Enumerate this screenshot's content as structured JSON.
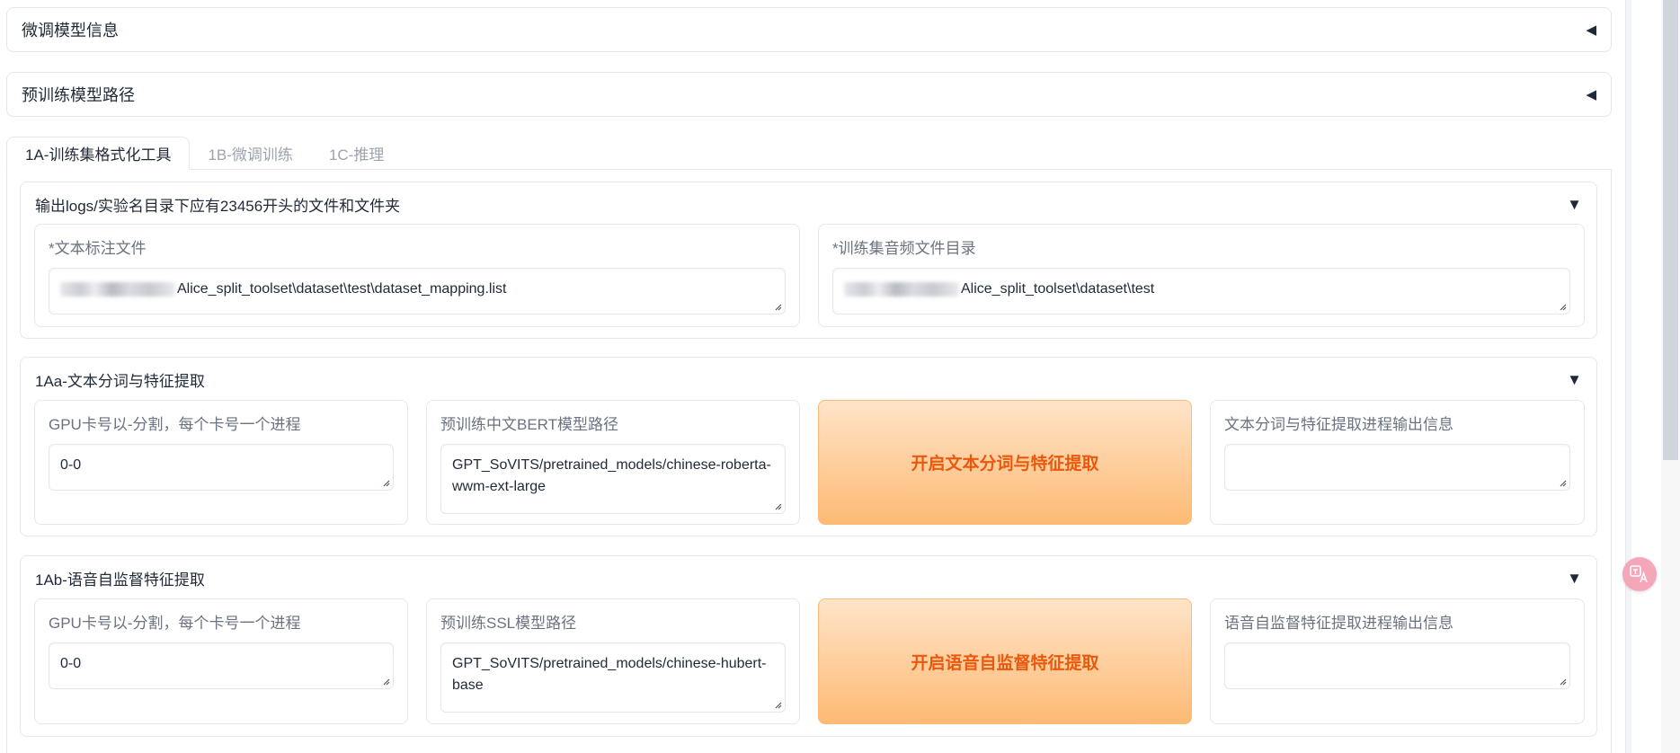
{
  "accordions": [
    {
      "title": "微调模型信息",
      "arrow": "◀"
    },
    {
      "title": "预训练模型路径",
      "arrow": "◀"
    }
  ],
  "tabs": [
    {
      "label": "1A-训练集格式化工具"
    },
    {
      "label": "1B-微调训练"
    },
    {
      "label": "1C-推理"
    }
  ],
  "group_output": {
    "title": "输出logs/实验名目录下应有23456开头的文件和文件夹",
    "arrow": "▼",
    "text_label_file": {
      "label": "*文本标注文件",
      "value": "Alice_split_toolset\\dataset\\test\\dataset_mapping.list"
    },
    "audio_dir": {
      "label": "*训练集音频文件目录",
      "value": "Alice_split_toolset\\dataset\\test"
    }
  },
  "group_1aa": {
    "title": "1Aa-文本分词与特征提取",
    "arrow": "▼",
    "gpu": {
      "label": "GPU卡号以-分割，每个卡号一个进程",
      "value": "0-0"
    },
    "bert_path": {
      "label": "预训练中文BERT模型路径",
      "value": "GPT_SoVITS/pretrained_models/chinese-roberta-wwm-ext-large"
    },
    "button": "开启文本分词与特征提取",
    "output": {
      "label": "文本分词与特征提取进程输出信息",
      "value": ""
    }
  },
  "group_1ab": {
    "title": "1Ab-语音自监督特征提取",
    "arrow": "▼",
    "gpu": {
      "label": "GPU卡号以-分割，每个卡号一个进程",
      "value": "0-0"
    },
    "ssl_path": {
      "label": "预训练SSL模型路径",
      "value": "GPT_SoVITS/pretrained_models/chinese-hubert-base"
    },
    "button": "开启语音自监督特征提取",
    "output": {
      "label": "语音自监督特征提取进程输出信息",
      "value": ""
    }
  },
  "icons": {
    "resize": "resize-grip-icon",
    "translate": "translate-icon"
  },
  "colors": {
    "accent": "#ea580c",
    "button_bg": "#fdba74",
    "border": "#e5e7eb"
  }
}
